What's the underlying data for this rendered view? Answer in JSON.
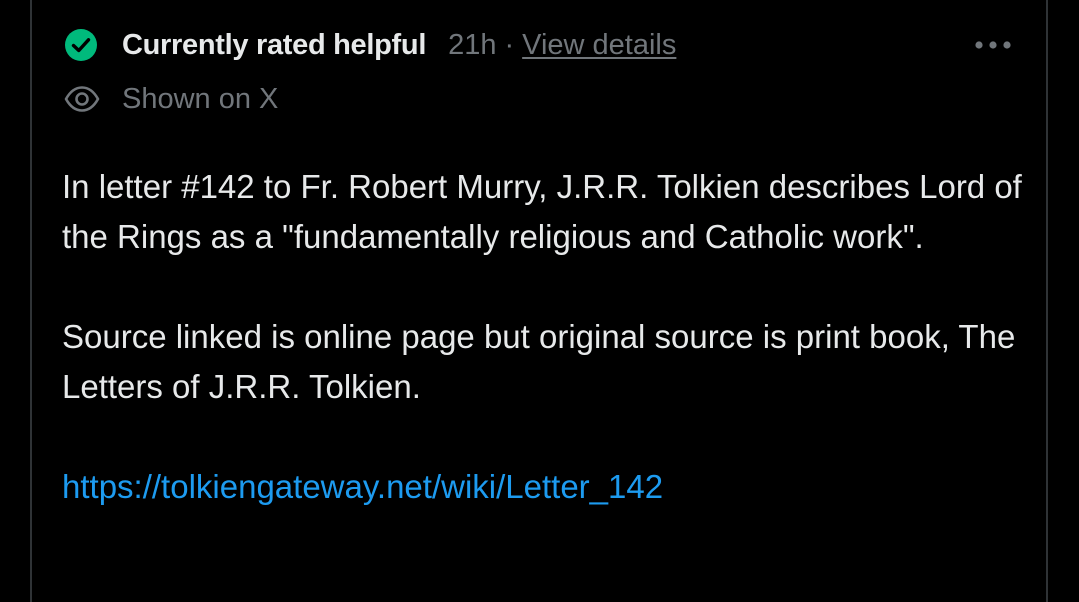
{
  "note": {
    "status_title": "Currently rated helpful",
    "time_ago": "21h",
    "separator": "·",
    "view_details_label": "View details",
    "shown_on_label": "Shown on X",
    "paragraphs": [
      "In letter #142 to Fr. Robert Murry, J.R.R. Tolkien describes Lord of the Rings as a \"fundamentally religious and Catholic work\".",
      "Source linked is online page but original source is print book, The Letters of J.R.R. Tolkien."
    ],
    "link_text": "https://tolkiengateway.net/wiki/Letter_142"
  },
  "icons": {
    "status": "check-circle-icon",
    "shown": "eye-icon",
    "more": "more-horizontal-icon"
  },
  "colors": {
    "background": "#000000",
    "primary_text": "#e7e9ea",
    "secondary_text": "#71767b",
    "accent_green": "#00ba7c",
    "link_blue": "#1d9bf0",
    "border": "#2f3336"
  }
}
